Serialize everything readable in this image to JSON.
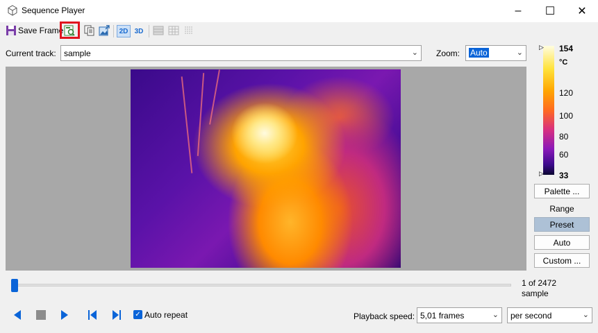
{
  "window": {
    "title": "Sequence Player",
    "controls": {
      "minimize": "–",
      "maximize": "☐",
      "close": "✕"
    }
  },
  "toolbar": {
    "save_frame_label": "Save Frame",
    "view_2d": "2D",
    "view_3d": "3D",
    "icons": [
      "save-icon",
      "save-as-image-icon",
      "copy-icon",
      "export-image-icon",
      "2d-view-icon",
      "3d-view-icon",
      "layout-single-icon",
      "layout-grid-icon",
      "layout-dots-icon"
    ]
  },
  "track": {
    "label": "Current track:",
    "value": "sample"
  },
  "zoom": {
    "label": "Zoom:",
    "value": "Auto"
  },
  "color_scale": {
    "max": "154",
    "unit": "°C",
    "ticks": [
      "120",
      "100",
      "80",
      "60"
    ],
    "min": "33",
    "palette_button": "Palette ...",
    "range_label": "Range",
    "preset_button": "Preset",
    "auto_button": "Auto",
    "custom_button": "Custom ..."
  },
  "timeline": {
    "position_fraction": 0.0,
    "frame_count": "1 of 2472",
    "track_name": "sample"
  },
  "playback": {
    "auto_repeat_label": "Auto repeat",
    "auto_repeat_checked": true,
    "speed_label": "Playback speed:",
    "speed_value": "5,01 frames",
    "speed_unit": "per second"
  },
  "colors": {
    "accent": "#0a64d8",
    "highlight_box": "#e0141e",
    "preset_active": "#adc1d6"
  }
}
